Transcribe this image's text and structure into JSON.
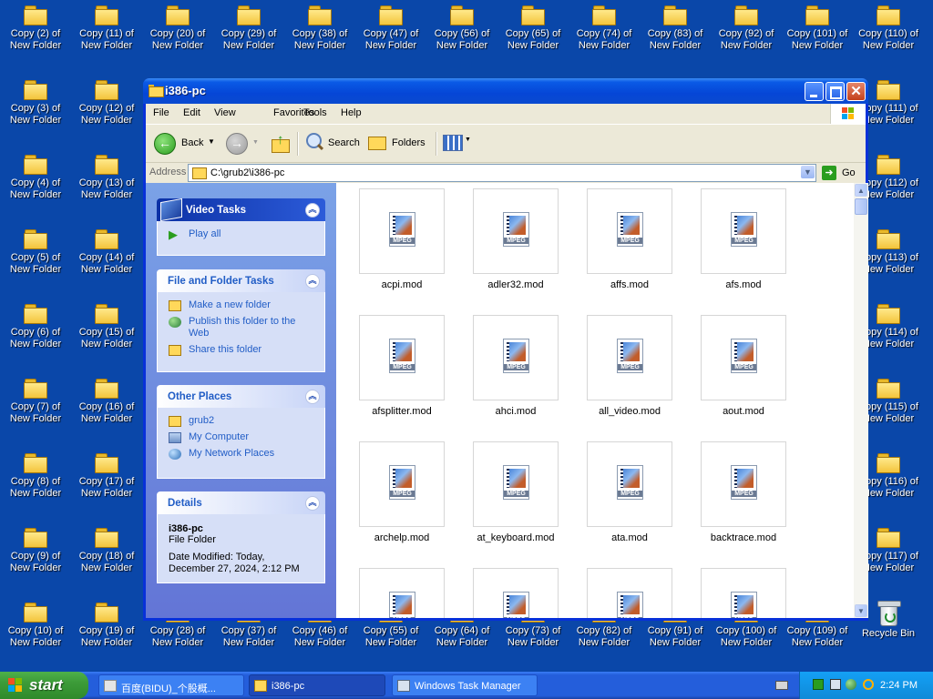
{
  "desktop": {
    "icons": [
      "Copy (2) of\nNew Folder",
      "Copy (11) of\nNew Folder",
      "Copy (20) of\nNew Folder",
      "Copy (29) of\nNew Folder",
      "Copy (38) of\nNew Folder",
      "Copy (47) of\nNew Folder",
      "Copy (56) of\nNew Folder",
      "Copy (65) of\nNew Folder",
      "Copy (74) of\nNew Folder",
      "Copy (83) of\nNew Folder",
      "Copy (92) of\nNew Folder",
      "Copy (101) of\nNew Folder",
      "Copy (110) of\nNew Folder",
      "Copy (3) of\nNew Folder",
      "Copy (12) of\nNew Folder",
      "Copy (111) of\nNew Folder",
      "Copy (4) of\nNew Folder",
      "Copy (13) of\nNew Folder",
      "Copy (112) of\nNew Folder",
      "Copy (5) of\nNew Folder",
      "Copy (14) of\nNew Folder",
      "Copy (113) of\nNew Folder",
      "Copy (6) of\nNew Folder",
      "Copy (15) of\nNew Folder",
      "Copy (114) of\nNew Folder",
      "Copy (7) of\nNew Folder",
      "Copy (16) of\nNew Folder",
      "Copy (115) of\nNew Folder",
      "Copy (8) of\nNew Folder",
      "Copy (17) of\nNew Folder",
      "Copy (116) of\nNew Folder",
      "Copy (9) of\nNew Folder",
      "Copy (18) of\nNew Folder",
      "Copy (117) of\nNew Folder",
      "Copy (10) of\nNew Folder",
      "Copy (19) of\nNew Folder",
      "Copy (28) of\nNew Folder",
      "Copy (37) of\nNew Folder",
      "Copy (46) of\nNew Folder",
      "Copy (55) of\nNew Folder",
      "Copy (64) of\nNew Folder",
      "Copy (73) of\nNew Folder",
      "Copy (82) of\nNew Folder",
      "Copy (91) of\nNew Folder",
      "Copy (100) of\nNew Folder",
      "Copy (109) of\nNew Folder"
    ],
    "recycle_bin": "Recycle Bin"
  },
  "window": {
    "title": "i386-pc",
    "menu": [
      "File",
      "Edit",
      "View",
      "Favorites",
      "Tools",
      "Help"
    ],
    "toolbar": {
      "back": "Back",
      "search": "Search",
      "folders": "Folders"
    },
    "address": {
      "label": "Address",
      "value": "C:\\grub2\\i386-pc",
      "go": "Go"
    },
    "task_pane": {
      "video_tasks": {
        "title": "Video Tasks",
        "items": [
          "Play all"
        ]
      },
      "file_folder_tasks": {
        "title": "File and Folder Tasks",
        "items": [
          "Make a new folder",
          "Publish this folder to the Web",
          "Share this folder"
        ]
      },
      "other_places": {
        "title": "Other Places",
        "items": [
          "grub2",
          "My Computer",
          "My Network Places"
        ]
      },
      "details": {
        "title": "Details",
        "name": "i386-pc",
        "type": "File Folder",
        "modified_label": "Date Modified: Today,",
        "modified_value": "December 27, 2024, 2:12 PM"
      }
    },
    "files": [
      "acpi.mod",
      "adler32.mod",
      "affs.mod",
      "afs.mod",
      "afsplitter.mod",
      "ahci.mod",
      "all_video.mod",
      "aout.mod",
      "archelp.mod",
      "at_keyboard.mod",
      "ata.mod",
      "backtrace.mod",
      "",
      "",
      "",
      ""
    ],
    "file_icon_label": "MPEG"
  },
  "taskbar": {
    "start": "start",
    "tasks": [
      "百度(BIDU)_个股概...",
      "i386-pc",
      "Windows Task Manager"
    ],
    "clock": "2:24 PM"
  },
  "colors": {
    "desktop": "#0a47a9",
    "titlebar": "#0546d6",
    "taskbar": "#245edb",
    "start": "#3c9b38",
    "link": "#215dc6"
  }
}
